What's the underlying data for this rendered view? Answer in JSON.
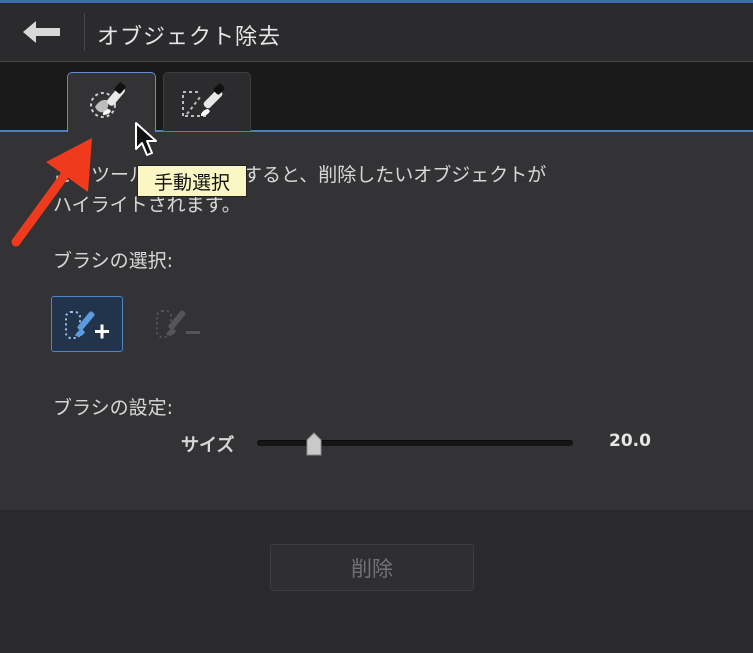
{
  "header": {
    "title": "オブジェクト除去",
    "back_icon": "back-arrow-icon"
  },
  "tabs": [
    {
      "name": "manual-select",
      "icon": "manual-brush-icon",
      "selected": true
    },
    {
      "name": "auto-select",
      "icon": "auto-brush-icon",
      "selected": false
    }
  ],
  "tooltip": {
    "text": "手動選択"
  },
  "description": {
    "line1": "このツールをクリックすると、削除したいオブジェクトが",
    "line2": "ハイライトされます。"
  },
  "brush_selection": {
    "label": "ブラシの選択:",
    "options": [
      {
        "name": "add-brush",
        "icon": "brush-plus-icon",
        "selected": true
      },
      {
        "name": "remove-brush",
        "icon": "brush-minus-icon",
        "selected": false,
        "disabled": true
      }
    ]
  },
  "brush_settings": {
    "label": "ブラシの設定:",
    "size_label": "サイズ",
    "size_value": "20.0"
  },
  "actions": {
    "delete_label": "削除",
    "delete_enabled": false
  },
  "colors": {
    "accent": "#4a7fc1",
    "annotation_arrow": "#f03a1e",
    "tooltip_bg": "#fbf7c5"
  }
}
